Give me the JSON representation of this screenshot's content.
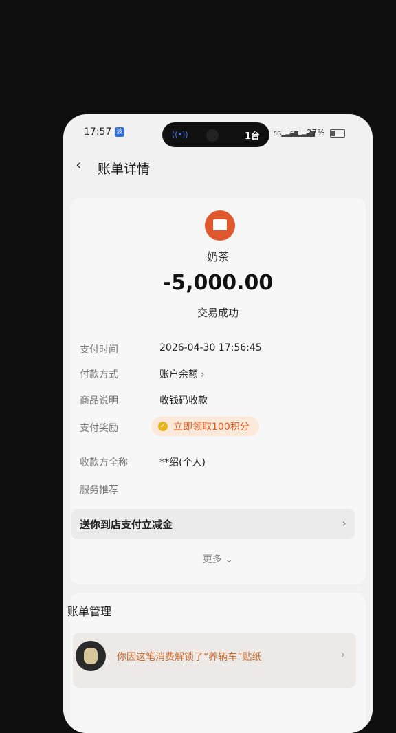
{
  "status_bar": {
    "time": "17:57",
    "device_label": "1台",
    "battery": "27%",
    "net1": "5G",
    "net2": "5G"
  },
  "header": {
    "title": "账单详情"
  },
  "summary": {
    "merchant": "奶茶",
    "amount": "-5,000.00",
    "status": "交易成功"
  },
  "details": [
    {
      "label": "支付时间",
      "value": "2026-04-30 17:56:45"
    },
    {
      "label": "付款方式",
      "value": "账户余额"
    },
    {
      "label": "商品说明",
      "value": "收钱码收款"
    },
    {
      "label": "支付奖励",
      "value": "立即领取100积分"
    },
    {
      "label": "收款方全称",
      "value": "**绍(个人)"
    },
    {
      "label": "服务推荐",
      "value": ""
    }
  ],
  "promo": {
    "label": "送你到店支付立减金"
  },
  "more": {
    "label": "更多"
  },
  "management": {
    "title": "账单管理",
    "sticker_text": "你因这笔消费解锁了“养辆车”贴纸"
  },
  "colors": {
    "accent": "#e05a20",
    "logo": "#e0582e"
  },
  "icons": {
    "back": "back-chevron-icon",
    "shop": "shop-icon",
    "reward": "coin-icon",
    "chevron": "chevron-right-icon"
  }
}
